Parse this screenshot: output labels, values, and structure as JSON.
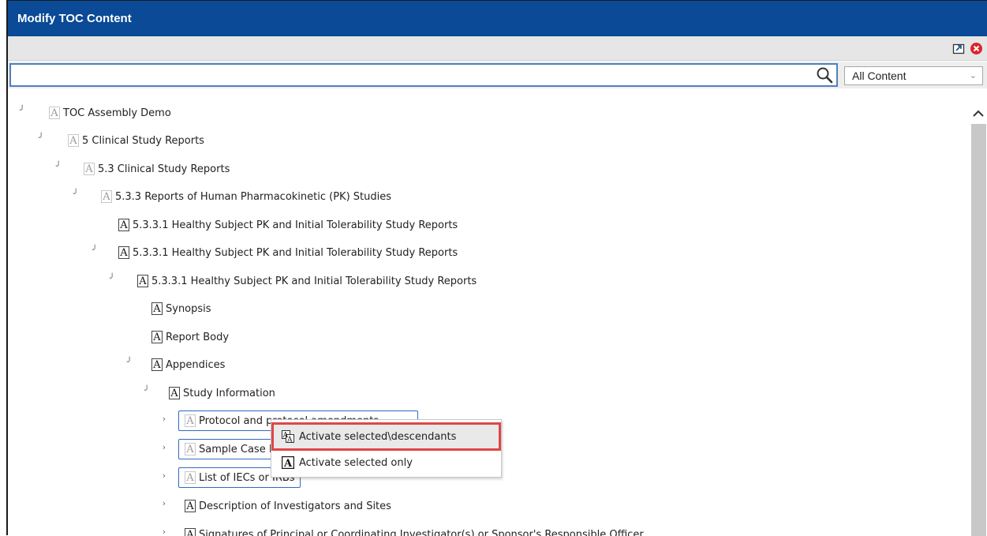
{
  "window": {
    "title": "Modify TOC Content"
  },
  "toolbar": {
    "export_icon": "export-icon",
    "close_icon": "close-circle-icon"
  },
  "search": {
    "value": "",
    "placeholder": "",
    "icon": "search-icon",
    "filter_selected": "All Content"
  },
  "tree": {
    "nodes": [
      {
        "label": "TOC Assembly Demo",
        "expanded": true,
        "active": false
      },
      {
        "label": "5 Clinical Study Reports",
        "expanded": true,
        "active": false
      },
      {
        "label": "5.3 Clinical Study Reports",
        "expanded": true,
        "active": false
      },
      {
        "label": "5.3.3 Reports of Human Pharmacokinetic (PK) Studies",
        "expanded": true,
        "active": false
      },
      {
        "label": "5.3.3.1 Healthy Subject PK and Initial Tolerability Study Reports",
        "expanded": null,
        "active": true
      },
      {
        "label": "5.3.3.1 Healthy Subject PK and Initial Tolerability Study Reports",
        "expanded": true,
        "active": true
      },
      {
        "label": "5.3.3.1 Healthy Subject PK and Initial Tolerability Study Reports",
        "expanded": true,
        "active": true
      },
      {
        "label": "Synopsis",
        "expanded": null,
        "active": true
      },
      {
        "label": "Report Body",
        "expanded": null,
        "active": true
      },
      {
        "label": "Appendices",
        "expanded": true,
        "active": true
      },
      {
        "label": "Study Information",
        "expanded": true,
        "active": true
      },
      {
        "label": "Protocol and protocol amendments",
        "expanded": false,
        "active": false,
        "selected": true
      },
      {
        "label": "Sample Case Report Forms",
        "expanded": false,
        "active": false,
        "selected": true
      },
      {
        "label": "List of IECs or IRBs",
        "expanded": false,
        "active": false,
        "selected": true
      },
      {
        "label": "Description of Investigators and Sites",
        "expanded": false,
        "active": true
      },
      {
        "label": "Signatures of Principal or Coordinating Investigator(s) or Sponsor's Responsible Officer",
        "expanded": false,
        "active": true
      }
    ]
  },
  "context_menu": {
    "items": [
      {
        "label": "Activate selected\\descendants",
        "icon": "activate-descendants-icon",
        "highlighted": true
      },
      {
        "label": "Activate selected only",
        "icon": "activate-icon",
        "highlighted": false
      }
    ]
  },
  "colors": {
    "title_bar": "#0a4a96",
    "highlight_outline": "#e04646",
    "selection_border": "#2f6bbf"
  }
}
